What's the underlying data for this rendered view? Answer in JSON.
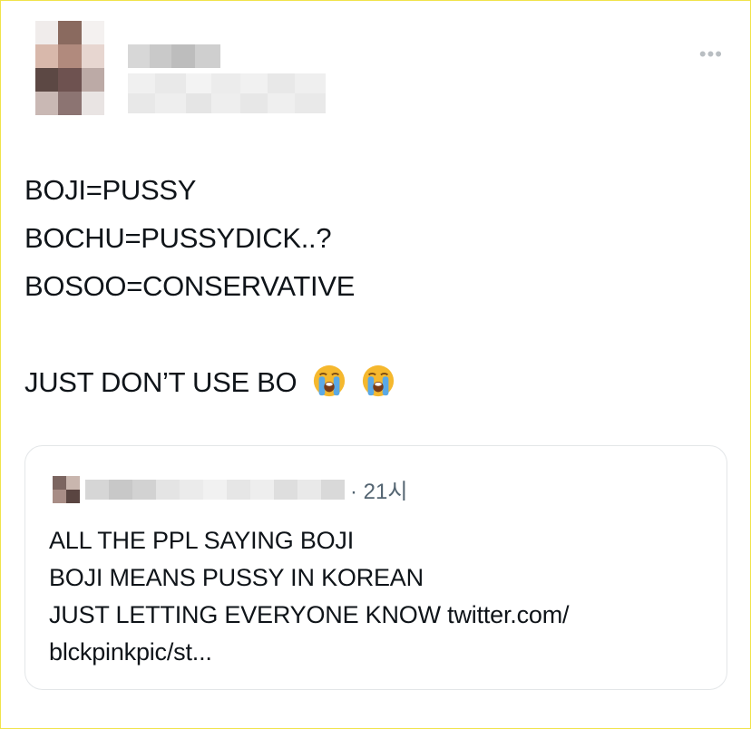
{
  "tweet": {
    "lines": [
      "BOJI=PUSSY",
      "BOCHU=PUSSYDICK..?",
      "BOSOO=CONSERVATIVE"
    ],
    "final_line": "JUST DON’T USE BO",
    "emoji": [
      "loudly-crying-face",
      "loudly-crying-face"
    ],
    "more_icon": "ellipsis-icon"
  },
  "quote": {
    "time": "· 21시",
    "lines": [
      "ALL THE PPL SAYING BOJI",
      "BOJI MEANS PUSSY IN KOREAN",
      "JUST LETTING EVERYONE KNOW twitter.com/",
      "blckpinkpic/st..."
    ]
  }
}
